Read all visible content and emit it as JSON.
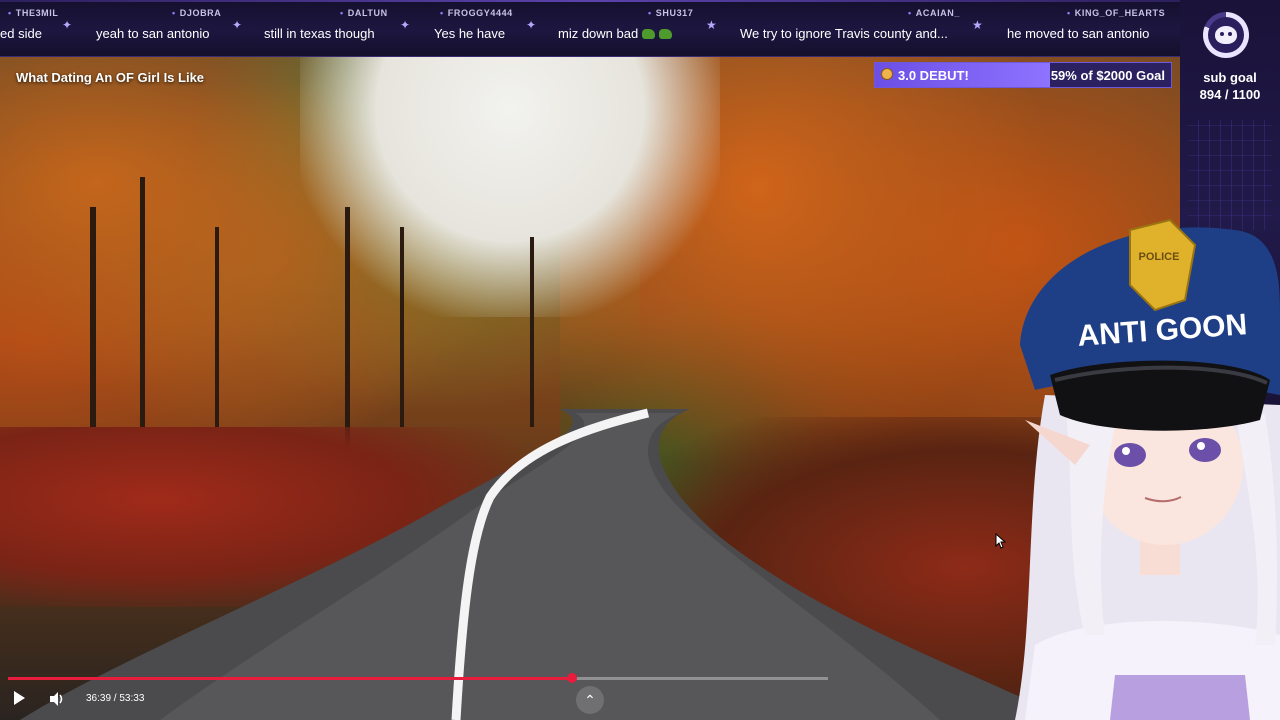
{
  "chat": [
    {
      "user": "THE3MIL",
      "text": "ed side"
    },
    {
      "user": "DJOBRA",
      "text": "yeah to san antonio"
    },
    {
      "user": "DALTUN",
      "text": "still in texas though"
    },
    {
      "user": "FROGGY4444",
      "text": "Yes he have"
    },
    {
      "user": "SHU317",
      "text": "miz down bad"
    },
    {
      "user": "ACAIAN_",
      "text": "We try to ignore Travis county and..."
    },
    {
      "user": "KING_OF_HEARTS",
      "text": "he moved to san antonio"
    }
  ],
  "sub_goal": {
    "label": "sub goal",
    "current": 894,
    "target": 1100,
    "count_text": "894 / 1100"
  },
  "debut_bar": {
    "left_text": "3.0 DEBUT!",
    "right_text": "59% of $2000 Goal",
    "progress": 0.59
  },
  "video": {
    "title": "What Dating An OF Girl Is Like",
    "time": "36:39 / 53:33",
    "progress": 0.6884
  },
  "avatar": {
    "hat_text": "ANTI GOON",
    "badge_text": "POLICE"
  },
  "colors": {
    "accent": "#8d73ff",
    "ticker_bg": "#1d1640",
    "progress": "#e81c3c"
  },
  "icons": [
    "play-icon",
    "volume-icon",
    "chevron-up-icon",
    "sub-goal-icon",
    "coin-icon",
    "cursor-icon"
  ]
}
